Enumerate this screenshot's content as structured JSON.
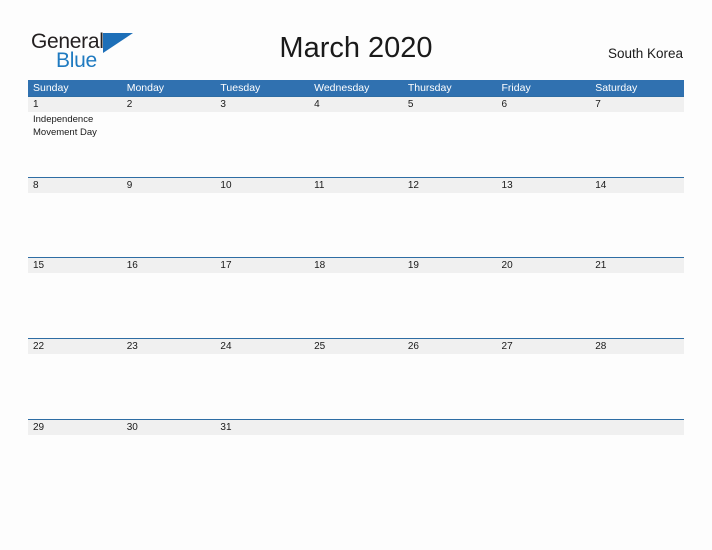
{
  "brand": {
    "name_part1": "General",
    "name_part2": "Blue",
    "accent_color": "#1d6fb8"
  },
  "header": {
    "title": "March 2020",
    "country": "South Korea"
  },
  "calendar": {
    "header_color": "#3071b0",
    "band_color": "#f0f0f0",
    "rule_color": "#2e6da4",
    "day_names": [
      "Sunday",
      "Monday",
      "Tuesday",
      "Wednesday",
      "Thursday",
      "Friday",
      "Saturday"
    ],
    "weeks": [
      {
        "days": [
          {
            "num": "1",
            "event": "Independence Movement Day"
          },
          {
            "num": "2",
            "event": ""
          },
          {
            "num": "3",
            "event": ""
          },
          {
            "num": "4",
            "event": ""
          },
          {
            "num": "5",
            "event": ""
          },
          {
            "num": "6",
            "event": ""
          },
          {
            "num": "7",
            "event": ""
          }
        ]
      },
      {
        "days": [
          {
            "num": "8",
            "event": ""
          },
          {
            "num": "9",
            "event": ""
          },
          {
            "num": "10",
            "event": ""
          },
          {
            "num": "11",
            "event": ""
          },
          {
            "num": "12",
            "event": ""
          },
          {
            "num": "13",
            "event": ""
          },
          {
            "num": "14",
            "event": ""
          }
        ]
      },
      {
        "days": [
          {
            "num": "15",
            "event": ""
          },
          {
            "num": "16",
            "event": ""
          },
          {
            "num": "17",
            "event": ""
          },
          {
            "num": "18",
            "event": ""
          },
          {
            "num": "19",
            "event": ""
          },
          {
            "num": "20",
            "event": ""
          },
          {
            "num": "21",
            "event": ""
          }
        ]
      },
      {
        "days": [
          {
            "num": "22",
            "event": ""
          },
          {
            "num": "23",
            "event": ""
          },
          {
            "num": "24",
            "event": ""
          },
          {
            "num": "25",
            "event": ""
          },
          {
            "num": "26",
            "event": ""
          },
          {
            "num": "27",
            "event": ""
          },
          {
            "num": "28",
            "event": ""
          }
        ]
      },
      {
        "days": [
          {
            "num": "29",
            "event": ""
          },
          {
            "num": "30",
            "event": ""
          },
          {
            "num": "31",
            "event": ""
          },
          {
            "num": "",
            "event": ""
          },
          {
            "num": "",
            "event": ""
          },
          {
            "num": "",
            "event": ""
          },
          {
            "num": "",
            "event": ""
          }
        ]
      }
    ]
  }
}
